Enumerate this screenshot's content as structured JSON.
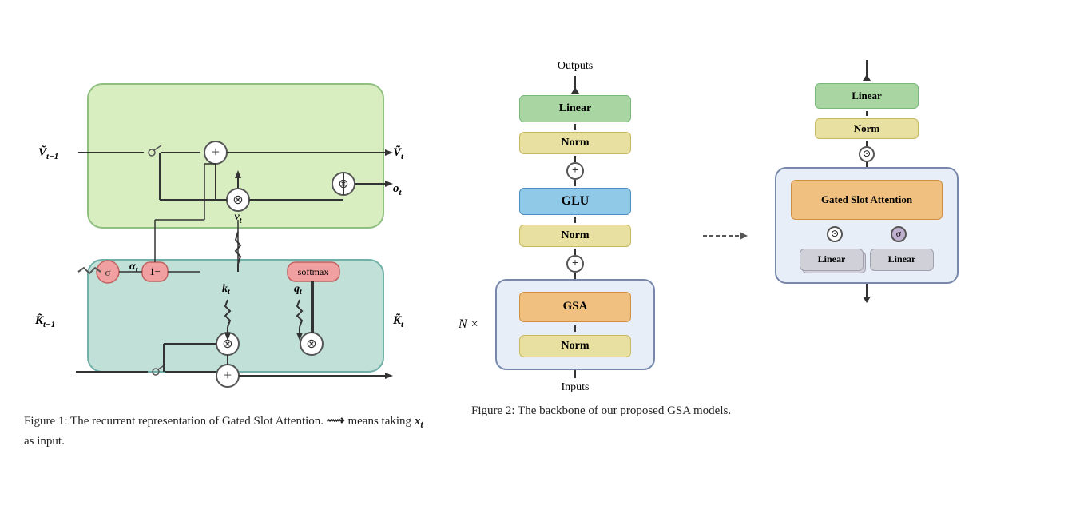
{
  "fig1": {
    "caption": "Figure 1: The recurrent representation of Gated Slot Attention.",
    "caption2": " means taking ",
    "caption3": " as input.",
    "labels": {
      "vtilde_prev": "Ṽt-1",
      "vtilde_curr": "Ṽt",
      "ot": "ot",
      "vt": "vt",
      "kt": "kt",
      "qt": "qt",
      "alpha": "αt",
      "sigma": "σ",
      "one_minus": "1-",
      "softmax": "softmax",
      "ktilde_prev": "K̃t-1",
      "ktilde_curr": "K̃t"
    }
  },
  "fig2": {
    "caption": "Figure 2: The backbone of our proposed GSA models.",
    "n_label": "N ×",
    "outputs_label": "Outputs",
    "inputs_label": "Inputs",
    "backbone": {
      "linear_label": "Linear",
      "norm_top_label": "Norm",
      "glu_label": "GLU",
      "norm_mid_label": "Norm",
      "gsa_label": "GSA",
      "norm_bot_label": "Norm"
    },
    "gsa_detail": {
      "linear_top_label": "Linear",
      "norm_label": "Norm",
      "gated_slot_label": "Gated Slot Attention",
      "linear_left_label": "Linear",
      "linear_right_label": "Linear"
    }
  }
}
